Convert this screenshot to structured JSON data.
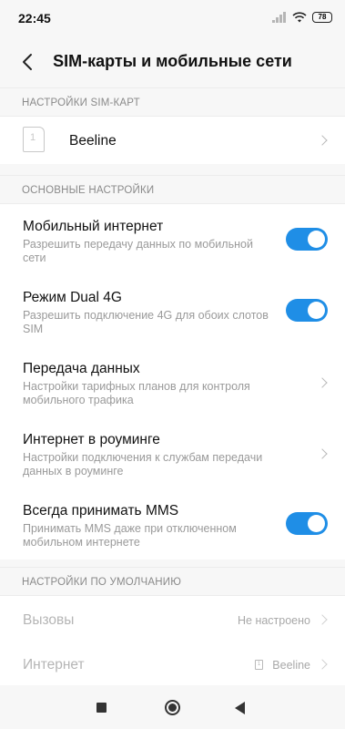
{
  "status_bar": {
    "time": "22:45",
    "battery": "78",
    "icons": [
      "signal-icon",
      "wifi-icon",
      "battery-icon"
    ]
  },
  "header": {
    "title": "SIM-карты и мобильные сети",
    "back_icon": "chevron-left-icon"
  },
  "sections": {
    "sim": {
      "header": "НАСТРОЙКИ SIM-КАРТ",
      "sim_slot": "1",
      "sim_name": "Beeline"
    },
    "main": {
      "header": "ОСНОВНЫЕ НАСТРОЙКИ"
    },
    "defaults": {
      "header": "НАСТРОЙКИ ПО УМОЛЧАНИЮ"
    }
  },
  "settings": {
    "mobile_internet": {
      "title": "Мобильный интернет",
      "subtitle": "Разрешить передачу данных по мобильной сети",
      "enabled": true
    },
    "dual_4g": {
      "title": "Режим Dual 4G",
      "subtitle": "Разрешить подключение 4G для обоих слотов SIM",
      "enabled": true
    },
    "data_transfer": {
      "title": "Передача данных",
      "subtitle": "Настройки тарифных планов для контроля мобильного трафика"
    },
    "roaming": {
      "title": "Интернет в роуминге",
      "subtitle": "Настройки подключения к службам передачи данных в роуминге"
    },
    "mms": {
      "title": "Всегда принимать MMS",
      "subtitle": "Принимать MMS даже при отключенном мобильном интернете",
      "enabled": true
    }
  },
  "defaults": {
    "calls": {
      "title": "Вызовы",
      "value": "Не настроено"
    },
    "internet": {
      "title": "Интернет",
      "sim_slot": "1",
      "value": "Beeline"
    }
  },
  "colors": {
    "accent": "#1f8ee6",
    "background": "#f7f7f7",
    "card": "#ffffff",
    "section_text": "#8a8a8a"
  }
}
